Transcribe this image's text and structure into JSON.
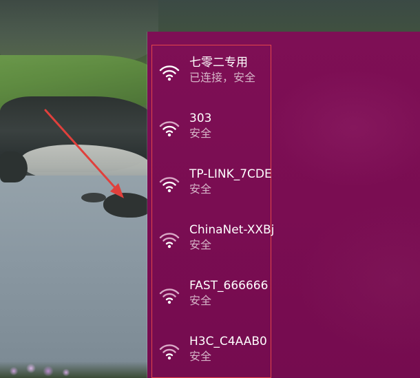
{
  "networks": [
    {
      "name": "七零二专用",
      "status": "已连接，安全",
      "icon": "wifi-signal-icon",
      "connected": true
    },
    {
      "name": "303",
      "status": "安全",
      "icon": "wifi-signal-icon",
      "connected": false
    },
    {
      "name": "TP-LINK_7CDE",
      "status": "安全",
      "icon": "wifi-signal-icon",
      "connected": false
    },
    {
      "name": "ChinaNet-XXBj",
      "status": "安全",
      "icon": "wifi-signal-icon",
      "connected": false
    },
    {
      "name": "FAST_666666",
      "status": "安全",
      "icon": "wifi-signal-icon",
      "connected": false
    },
    {
      "name": "H3C_C4AAB0",
      "status": "安全",
      "icon": "wifi-signal-icon",
      "connected": false
    }
  ],
  "colors": {
    "panel_bg": "#7a0d52",
    "highlight_border": "#e4464a",
    "arrow": "#e0403c",
    "text_primary": "#ffffff",
    "text_secondary": "#d6b5c8"
  }
}
